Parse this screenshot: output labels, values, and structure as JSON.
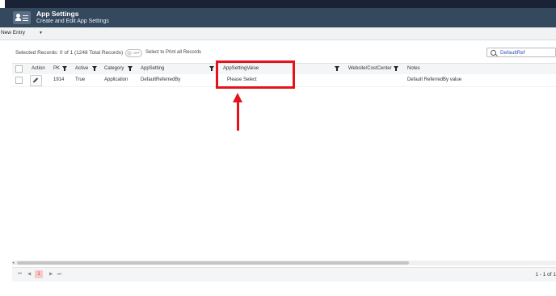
{
  "header": {
    "title": "App Settings",
    "subtitle": "Create and Edit App Settings",
    "icon": "app-settings-icon"
  },
  "toolbar": {
    "new_entry_label": "New Entry",
    "caret": "▼"
  },
  "selection": {
    "text": "Selected Records: 0 of 1 (1248 Total Records)",
    "toggle_state": "OFF",
    "print_label": "Select to Print all Records"
  },
  "search": {
    "value": "DefaultRef"
  },
  "grid": {
    "columns": {
      "action": "Action",
      "pk": "PK",
      "active": "Active",
      "category": "Category",
      "app_setting": "AppSetting",
      "app_setting_value": "AppSettingValue",
      "website": "Website/CostCenter",
      "notes": "Notes"
    },
    "rows": [
      {
        "pk": "1914",
        "active": "True",
        "category": "Application",
        "app_setting": "DefaultReferredBy",
        "app_setting_value": "Please Select",
        "website": "",
        "notes": "Default ReferredBy value"
      }
    ]
  },
  "pager": {
    "first": "⏮",
    "prev": "◀",
    "current_page": "1",
    "next": "▶",
    "last": "⏭",
    "info": "1 - 1 of 1"
  },
  "colors": {
    "header_bg": "#34495e",
    "annotation_red": "#e3141c",
    "current_page_bg": "#f8c9c9"
  }
}
